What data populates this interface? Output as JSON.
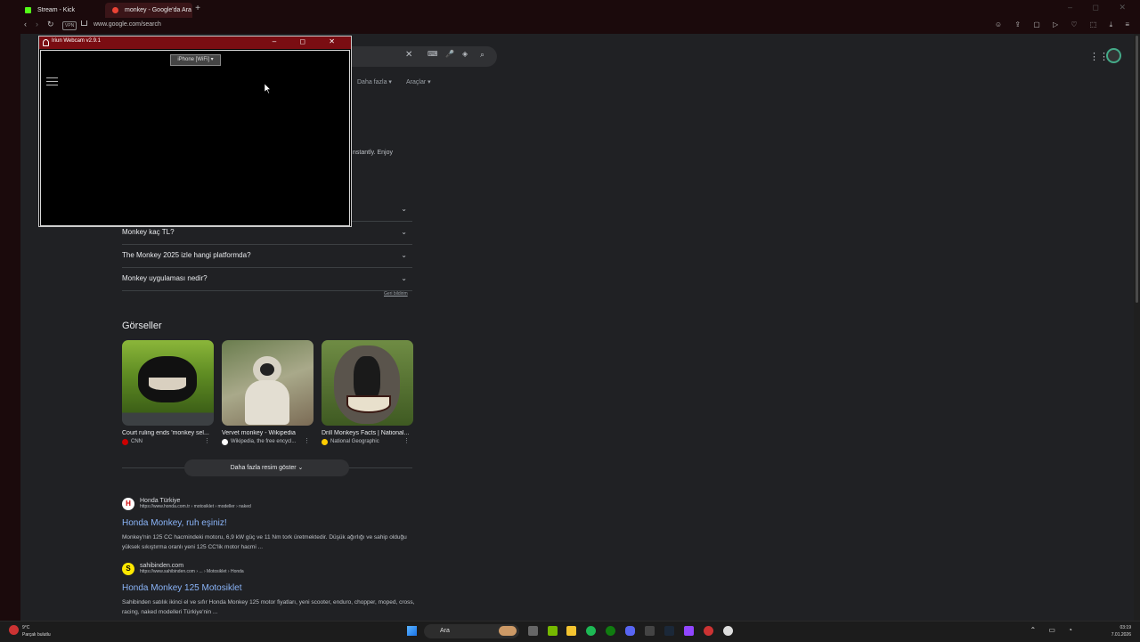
{
  "browser": {
    "tabs": [
      {
        "label": "Stream - Kick Dashboard",
        "color": "#53fc18"
      },
      {
        "label": "monkey - Google'da Ara",
        "color": "#ea4335"
      }
    ],
    "new_tab": "+",
    "url": "www.google.com/search",
    "vpn_label": "VPN",
    "back": "‹",
    "forward": "›",
    "reload": "↻",
    "toolbar_icons": "☺ ⇪ ▢ ▷ ♡ ⬚ ⤓ ≡",
    "window_controls": "– ◻ ✕"
  },
  "google": {
    "search_clear": "✕",
    "tools": [
      {
        "label": "Daha fazla ▾"
      },
      {
        "label": "Araçlar ▾"
      }
    ],
    "snippet_fragment": "nstantly. Enjoy",
    "faq": [
      {
        "q": ""
      },
      {
        "q": "Monkey kaç TL?"
      },
      {
        "q": "The Monkey 2025 izle hangi platformda?"
      },
      {
        "q": "Monkey uygulaması nedir?"
      }
    ],
    "feedback": "Geri bildirim",
    "images_title": "Görseller",
    "images": [
      {
        "caption": "Court ruling ends 'monkey sel...",
        "source": "CNN",
        "source_color": "#cc0000"
      },
      {
        "caption": "Vervet monkey - Wikipedia",
        "source": "Wikipedia, the free encycl...",
        "source_color": "#ffffff"
      },
      {
        "caption": "Drill Monkeys Facts | National...",
        "source": "National Geographic",
        "source_color": "#ffcc00"
      }
    ],
    "more_images": "Daha fazla resim göster ⌄",
    "results": [
      {
        "site": "Honda Türkiye",
        "url": "https://www.honda.com.tr › motosiklet › modeller › naked",
        "title": "Honda Monkey, ruh eşiniz!",
        "desc": "Monkey'nin 125 CC hacmindeki motoru, 6,9 kW güç ve 11 Nm tork üretmektedir. Düşük ağırlığı ve sahip olduğu yüksek sıkıştırma oranlı yeni 125 CC'lik motor hacmi ...",
        "logo": "H",
        "logo_bg": "#ffffff",
        "logo_fg": "#cc0000"
      },
      {
        "site": "sahibinden.com",
        "url": "https://www.sahibinden.com › ... › Motosiklet › Honda",
        "title": "Honda Monkey 125 Motosiklet",
        "desc": "Sahibinden satılık ikinci el ve sıfır Honda Monkey 125 motor fiyatları, yeni scooter, enduro, chopper, moped, cross, racing, naked modelleri Türkiye'nin ...",
        "logo": "S",
        "logo_bg": "#ffe800",
        "logo_fg": "#000000"
      }
    ]
  },
  "webcam": {
    "title": "Iriun Webcam v2.9.1",
    "device": "iPhone [WiFi] ▾",
    "controls": "– ◻ ✕"
  },
  "taskbar": {
    "temperature": "9°C",
    "weather": "Parçalı bulutlu",
    "search_placeholder": "Ara",
    "tray": "⌃ ▭ ◔",
    "time": "03:19",
    "date": "7.01.2026"
  }
}
